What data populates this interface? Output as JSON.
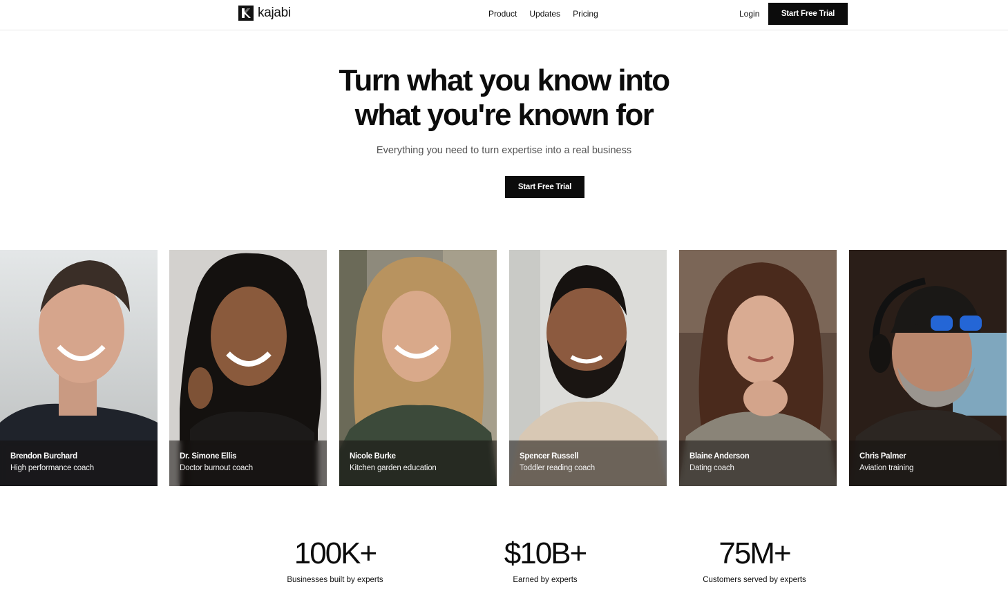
{
  "brand": {
    "name": "kajabi"
  },
  "nav": {
    "links": [
      "Product",
      "Updates",
      "Pricing"
    ],
    "login": "Login",
    "cta": "Start Free Trial"
  },
  "hero": {
    "title_line1": "Turn what you know into",
    "title_line2": "what you're known for",
    "subtitle": "Everything you need to turn expertise into a real business",
    "cta": "Start Free Trial"
  },
  "creators": [
    {
      "name": "Brendon Burchard",
      "role": "High performance coach"
    },
    {
      "name": "Dr. Simone Ellis",
      "role": "Doctor burnout coach"
    },
    {
      "name": "Nicole Burke",
      "role": "Kitchen garden education"
    },
    {
      "name": "Spencer Russell",
      "role": "Toddler reading coach"
    },
    {
      "name": "Blaine Anderson",
      "role": "Dating coach"
    },
    {
      "name": "Chris Palmer",
      "role": "Aviation training"
    }
  ],
  "stats": [
    {
      "value": "100K+",
      "label": "Businesses built by experts"
    },
    {
      "value": "$10B+",
      "label": "Earned by experts"
    },
    {
      "value": "75M+",
      "label": "Customers served by experts"
    }
  ],
  "colors": {
    "primary": "#0c0c0c",
    "text_muted": "#555555",
    "background": "#ffffff"
  }
}
